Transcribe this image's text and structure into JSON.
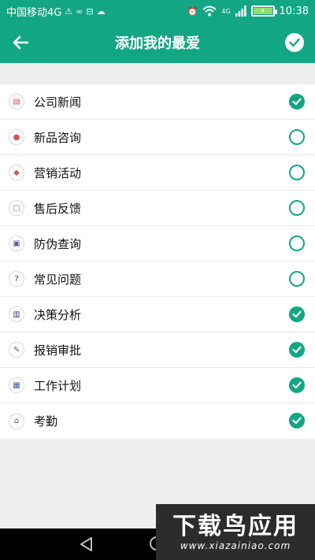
{
  "status_bar": {
    "carrier": "中国移动4G",
    "network": "4G",
    "time": "10:38"
  },
  "header": {
    "title": "添加我的最爱"
  },
  "colors": {
    "primary": "#13a684"
  },
  "favorites": [
    {
      "label": "公司新闻",
      "icon": "news-icon",
      "checked": true
    },
    {
      "label": "新品咨询",
      "icon": "new-product-icon",
      "checked": false
    },
    {
      "label": "营销活动",
      "icon": "tag-icon",
      "checked": false
    },
    {
      "label": "售后反馈",
      "icon": "feedback-icon",
      "checked": false
    },
    {
      "label": "防伪查询",
      "icon": "anti-fake-icon",
      "checked": false
    },
    {
      "label": "常见问题",
      "icon": "question-icon",
      "checked": false
    },
    {
      "label": "决策分析",
      "icon": "chart-icon",
      "checked": true
    },
    {
      "label": "报销审批",
      "icon": "approval-icon",
      "checked": true
    },
    {
      "label": "工作计划",
      "icon": "plan-icon",
      "checked": true
    },
    {
      "label": "考勤",
      "icon": "attendance-icon",
      "checked": true
    }
  ],
  "watermark": {
    "name": "下载鸟应用",
    "url": "www.xiazainiao.com"
  }
}
